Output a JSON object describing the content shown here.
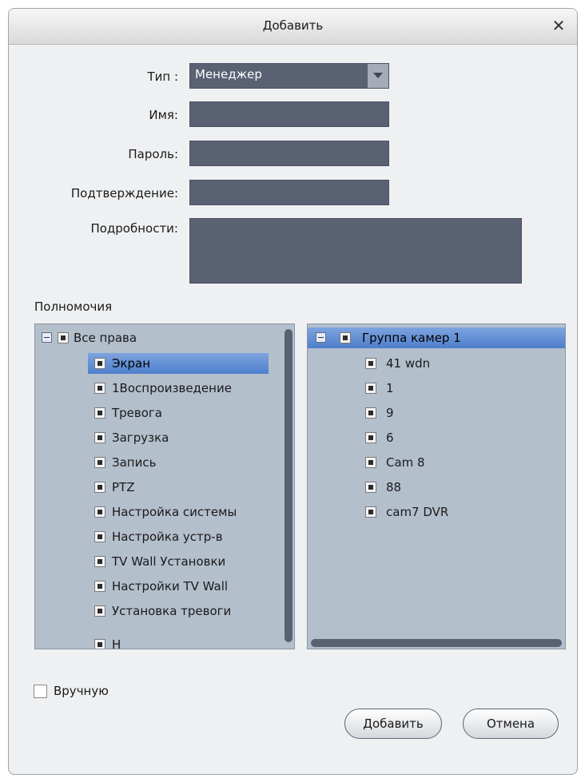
{
  "dialog": {
    "title": "Добавить",
    "close_label": "✕"
  },
  "form": {
    "type_label": "Тип :",
    "type_value": "Менеджер",
    "name_label": "Имя:",
    "name_value": "",
    "password_label": "Пароль:",
    "password_value": "",
    "confirm_label": "Подтверждение:",
    "confirm_value": "",
    "details_label": "Подробности:",
    "details_value": ""
  },
  "permissions": {
    "section_label": "Полномочия",
    "root_label": "Все права",
    "items": [
      "Экран",
      "1Воспроизведение",
      "Тревога",
      "Загрузка",
      "Запись",
      "PTZ",
      "Настройка системы",
      "Настройка устр-в",
      "TV Wall Установки",
      "Настройки TV Wall",
      "Установка тревоги",
      "Н"
    ]
  },
  "cameras": {
    "group_label": "Группа камер 1",
    "items": [
      "41 wdn",
      "1",
      "9",
      "6",
      "Cam 8",
      "88",
      "cam7 DVR"
    ]
  },
  "manual": {
    "label": "Вручную"
  },
  "buttons": {
    "add_label": "Добавить",
    "cancel_label": "Отмена"
  },
  "colors": {
    "field_bg": "#5a6173",
    "panel_bg": "#b4bfcc",
    "selection": "#5b8ad3"
  }
}
